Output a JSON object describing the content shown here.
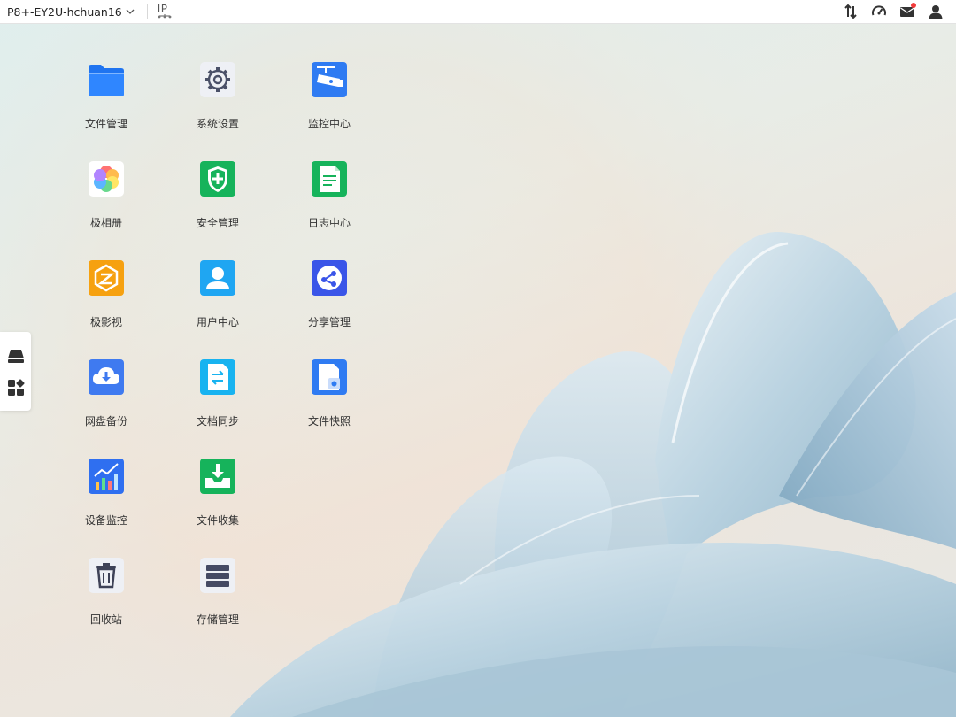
{
  "topbar": {
    "device_name": "P8+-EY2U-hchuan16",
    "ip_label": "IP"
  },
  "icons": {
    "transfer": "transfer-icon",
    "speed": "speedometer-icon",
    "mail": "mail-icon",
    "user": "user-icon",
    "dock_storage": "storage-drive-icon",
    "dock_apps": "app-grid-icon"
  },
  "colors": {
    "accent_blue": "#2f7bf2",
    "green": "#17b35a",
    "orange": "#f6a110",
    "alert_red": "#f23b3b"
  },
  "apps": [
    {
      "label": "文件管理"
    },
    {
      "label": "系统设置"
    },
    {
      "label": "监控中心"
    },
    {
      "label": "极相册"
    },
    {
      "label": "安全管理"
    },
    {
      "label": "日志中心"
    },
    {
      "label": "极影视"
    },
    {
      "label": "用户中心"
    },
    {
      "label": "分享管理"
    },
    {
      "label": "网盘备份"
    },
    {
      "label": "文档同步"
    },
    {
      "label": "文件快照"
    },
    {
      "label": "设备监控"
    },
    {
      "label": "文件收集"
    },
    {
      "label": "回收站"
    },
    {
      "label": "存储管理"
    }
  ]
}
